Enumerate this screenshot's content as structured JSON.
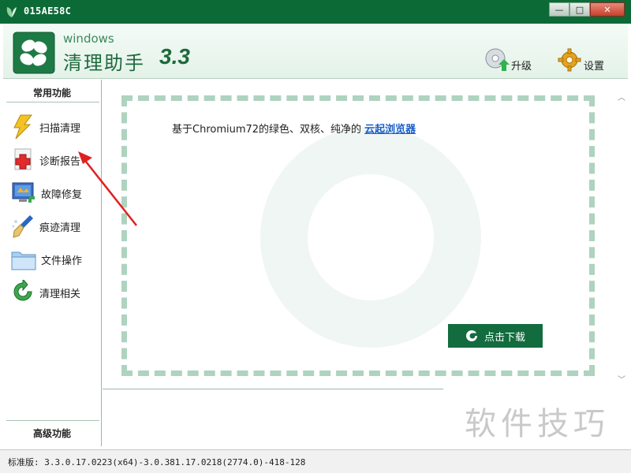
{
  "window": {
    "title": "015AE58C",
    "minimize": "—",
    "maximize": "□",
    "close": "✕"
  },
  "header": {
    "brand_windows": "windows",
    "brand_name": "清理助手",
    "brand_version": "3.3",
    "upgrade_label": "升级",
    "settings_label": "设置"
  },
  "sidebar": {
    "common_title": "常用功能",
    "advanced_title": "高级功能",
    "items": [
      {
        "label": "扫描清理",
        "icon": "lightning-icon"
      },
      {
        "label": "诊断报告",
        "icon": "medical-cross-icon"
      },
      {
        "label": "故障修复",
        "icon": "repair-monitor-icon"
      },
      {
        "label": "痕迹清理",
        "icon": "broom-icon"
      },
      {
        "label": "文件操作",
        "icon": "folder-icon"
      },
      {
        "label": "清理相关",
        "icon": "refresh-icon"
      }
    ]
  },
  "content": {
    "promo_text": "基于Chromium72的绿色、双核、纯净的",
    "promo_link": "云起浏览器",
    "download_label": "点击下载"
  },
  "status": {
    "version_text": "标准版: 3.3.0.17.0223(x64)-3.0.381.17.0218(2774.0)-418-128"
  },
  "overlay": {
    "watermark_text": "软件技巧"
  },
  "colors": {
    "title_green": "#0c6a37",
    "accent_green": "#126c3e",
    "link_blue": "#1a5fc8",
    "annotation_red": "#e02020"
  }
}
